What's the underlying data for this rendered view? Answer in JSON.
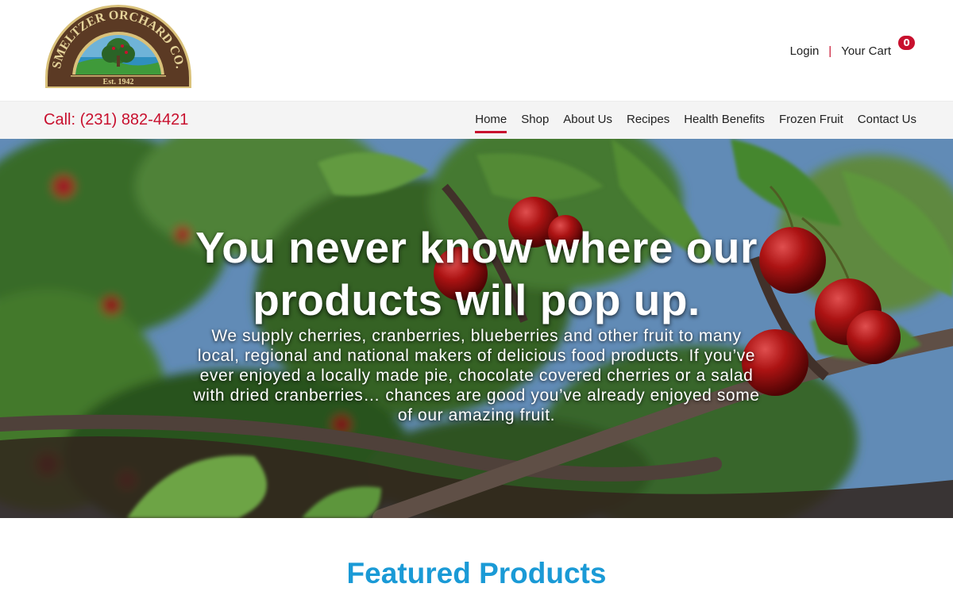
{
  "logo": {
    "brand_name": "SMELTZER ORCHARD CO.",
    "established": "Est. 1942"
  },
  "account": {
    "login": "Login",
    "separator": "|",
    "cart": "Your Cart",
    "cart_count": "0"
  },
  "nav": {
    "phone": "Call: (231) 882-4421",
    "items": [
      {
        "label": "Home",
        "active": true
      },
      {
        "label": "Shop"
      },
      {
        "label": "About Us"
      },
      {
        "label": "Recipes"
      },
      {
        "label": "Health Benefits"
      },
      {
        "label": "Frozen Fruit"
      },
      {
        "label": "Contact Us"
      }
    ]
  },
  "hero": {
    "title": "You never know where our products will pop up.",
    "text": "We supply cherries, cranberries, blueberries and other fruit to many local, regional and national makers of delicious food products. If you’ve ever enjoyed a locally made pie, chocolate covered cherries or a salad with dried cranberries… chances are good you’ve already enjoyed some of our amazing fruit."
  },
  "featured": {
    "title": "Featured Products"
  },
  "colors": {
    "accent_red": "#c8102e",
    "heading_blue": "#1a9ad6",
    "nav_bg": "#f4f4f4",
    "logo_brown": "#5b3a24",
    "logo_gold": "#d9c17a"
  },
  "icons": {
    "cart": "shopping-cart-icon"
  }
}
